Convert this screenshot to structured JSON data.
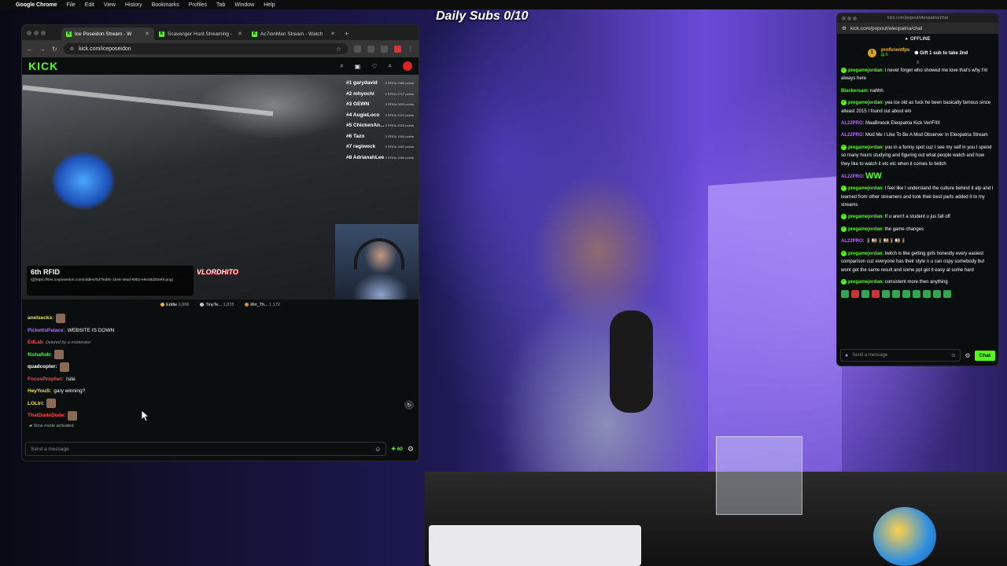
{
  "menubar": {
    "items": [
      "Google Chrome",
      "File",
      "Edit",
      "View",
      "History",
      "Bookmarks",
      "Profiles",
      "Tab",
      "Window",
      "Help"
    ]
  },
  "overlay": {
    "title": "Daily Subs 0/10"
  },
  "browser": {
    "tabs": [
      {
        "label": "Ice Poseidon Stream - W",
        "active": true
      },
      {
        "label": "Scavenger Hunt Streaming -",
        "active": false
      },
      {
        "label": "Ac7ionMan Stream - Watch",
        "active": false
      }
    ],
    "url": "kick.com/iceposeidon",
    "logo": "KICK",
    "leaderboard": [
      {
        "rank": "#1 garydavid",
        "pts": "2 RFIDs 2985 points"
      },
      {
        "rank": "#2 mhyochi",
        "pts": "2 RFIDs 2717 points"
      },
      {
        "rank": "#3 GEWN",
        "pts": "3 RFIDs 2603 points"
      },
      {
        "rank": "#4 AugieLoco",
        "pts": "3 RFIDs 2210 points"
      },
      {
        "rank": "#5 ChickenAn...",
        "pts": "3 RFIDs 2025 points"
      },
      {
        "rank": "#6 Tazo",
        "pts": "3 RFIDs 1900 points"
      },
      {
        "rank": "#7 regiwock",
        "pts": "3 RFIDs 1652 points"
      },
      {
        "rank": "#8 AdrianahLee",
        "pts": "3 RFIDs 1566 points"
      }
    ],
    "rfid": {
      "title": "6th RFID",
      "url": "![](https://files.iceposeidon.com/riddles/0d7fed8c-1be6-46ad-89b2-e9e48d3f3ef6.png)"
    },
    "overlay_logo": "VLORDHITO",
    "viewers": [
      {
        "name": "Eddie",
        "count": "2,666",
        "color": "#f3b33a"
      },
      {
        "name": "TinyTe...",
        "count": "1,878",
        "color": "#c9c9c9"
      },
      {
        "name": "Riri_Th...",
        "count": "1,172",
        "color": "#e08a3a"
      }
    ],
    "chat": [
      {
        "user": "anelsecks:",
        "color": "#f3e34a",
        "msg": "",
        "emote": true
      },
      {
        "user": "PickettsPalace:",
        "color": "#b46cff",
        "msg": "WEBSITE IS DOWN",
        "emote": false
      },
      {
        "user": "EdLab",
        "color": "#ff4b4b",
        "msg": "",
        "deleted": "Deleted by a moderator"
      },
      {
        "user": "flishafish:",
        "color": "#53fc18",
        "msg": "",
        "emote": true
      },
      {
        "user": "quadcopter:",
        "color": "#ffffff",
        "msg": "",
        "emote": true
      },
      {
        "user": "FocusProphet:",
        "color": "#ff4b4b",
        "msg": "!site",
        "emote": false
      },
      {
        "user": "HeyYouS:",
        "color": "#f3e34a",
        "msg": "gary winning?",
        "emote": false
      },
      {
        "user": "LOLIri:",
        "color": "#f3e34a",
        "msg": "",
        "emote": true
      },
      {
        "user": "ThatDudeDude:",
        "color": "#ff4b4b",
        "msg": "",
        "emote": true
      }
    ],
    "slowmode": "Slow mode activated",
    "send_placeholder": "Send a message",
    "points": "60"
  },
  "popout": {
    "title": "kick.com/popout/eleopatria/chat",
    "url": "kick.com/popout/eleopatria/chat",
    "status": "OFFLINE",
    "gifter": {
      "badge": "1",
      "name": "proficientfps",
      "count": "5",
      "gift": "Gift 1 sub to take 2nd"
    },
    "messages": [
      {
        "user": "pregamejordan",
        "color": "#53fc18",
        "check": true,
        "msg": "I never forget who showed me love that's why I'm always here"
      },
      {
        "user": "Blackersam",
        "color": "#53fc18",
        "check": false,
        "msg": "nahhh"
      },
      {
        "user": "pregamejordan",
        "color": "#53fc18",
        "check": true,
        "msg": "yea ice old as fuck he been basically famous since atleast 2015 I found out about em"
      },
      {
        "user": "AL22PRO",
        "color": "#b46cff",
        "check": false,
        "msg": "MaaBroook Eleopatria Kick VeriFIIII"
      },
      {
        "user": "AL22PRO",
        "color": "#b46cff",
        "check": false,
        "msg": "Mod Me I Like To Be A Mod Observer In Eleopatria Stream"
      },
      {
        "user": "pregamejordan",
        "color": "#53fc18",
        "check": true,
        "msg": "you in a funny spot cuz I see my self in you I spend so many hours studying and figuring out what people watch and how they like to watch it etc etc when it comes to twitch"
      },
      {
        "user": "AL22PRO",
        "color": "#b46cff",
        "check": false,
        "msg": "",
        "ww": "WW"
      },
      {
        "user": "pregamejordan",
        "color": "#53fc18",
        "check": true,
        "msg": "I feel like I understand the culture behind it atp and I learned from other streamers and took their best parts added it to my streams"
      },
      {
        "user": "pregamejordan",
        "color": "#53fc18",
        "check": true,
        "msg": "If u aren't a student u jus fall off"
      },
      {
        "user": "pregamejordan",
        "color": "#53fc18",
        "check": true,
        "msg": "the game changes"
      },
      {
        "user": "AL22PRO",
        "color": "#b46cff",
        "check": false,
        "msg": "🚦🍱🚦🍱🚦🍱🚦"
      },
      {
        "user": "pregamejordan",
        "color": "#53fc18",
        "check": true,
        "msg": "twitch is like getting girls honestly every easiest comparison cuz everyone has their style n u can copy somebody but wont get the same result and some ppl got it easy at some hard"
      },
      {
        "user": "pregamejordan",
        "color": "#53fc18",
        "check": true,
        "msg": "consistent more then anything"
      }
    ],
    "send_placeholder": "Send a message",
    "chat_button": "Chat"
  }
}
